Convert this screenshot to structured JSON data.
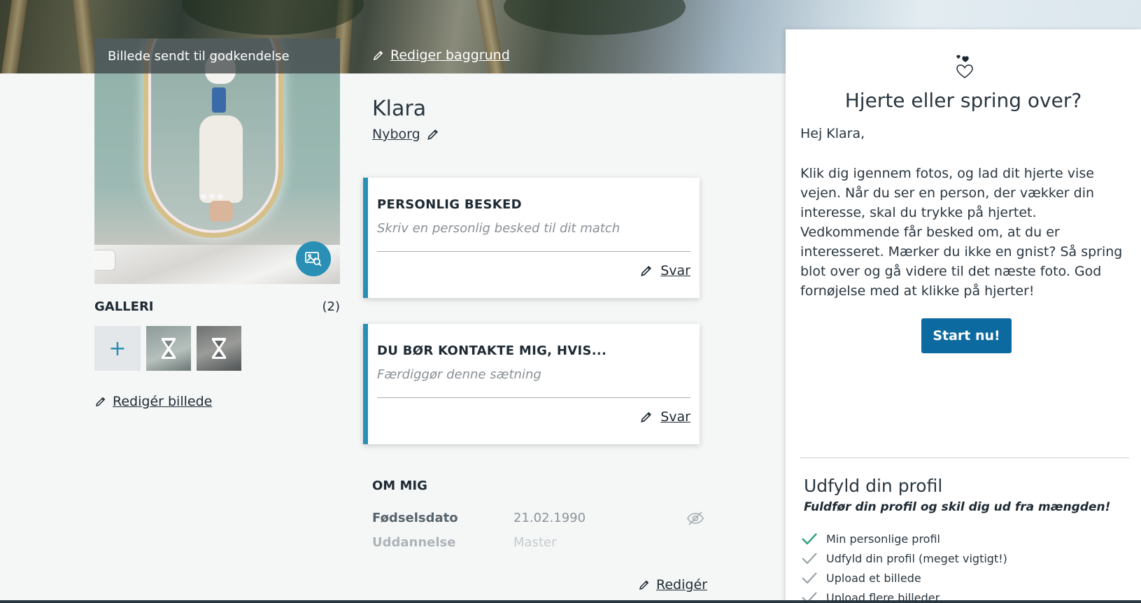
{
  "hero": {
    "edit_background_label": "Rediger baggrund"
  },
  "photo": {
    "approval_text": "Billede sendt til godkendelse"
  },
  "gallery": {
    "title": "GALLERI",
    "count": "(2)",
    "edit_photo_label": "Redigér billede"
  },
  "profile": {
    "name": "Klara",
    "city": "Nyborg"
  },
  "questions": [
    {
      "title": "PERSONLIG BESKED",
      "placeholder": "Skriv en personlig besked til dit match",
      "answer_label": "Svar"
    },
    {
      "title": "DU BØR KONTAKTE MIG, HVIS...",
      "placeholder": "Færdiggør denne sætning",
      "answer_label": "Svar"
    }
  ],
  "about": {
    "title": "OM MIG",
    "rows": [
      {
        "label": "Fødselsdato",
        "value": "21.02.1990"
      },
      {
        "label": "Uddannelse",
        "value": "Master"
      }
    ],
    "edit_label": "Redigér"
  },
  "panel": {
    "title": "Hjerte eller spring over?",
    "greeting": "Hej Klara,",
    "body": "Klik dig igennem fotos, og lad dit hjerte vise vejen. Når du ser en person, der vækker din interesse, skal du trykke på hjertet. Vedkommende får besked om, at du er interesseret. Mærker du ikke en gnist? Så spring blot over og gå videre til det næste foto. God fornøjelse med at klikke på hjerter!",
    "start_label": "Start nu!",
    "profile_title": "Udfyld din profil",
    "profile_subtitle": "Fuldfør din profil og skil dig ud fra mængden!",
    "checklist": [
      {
        "label": "Min personlige profil",
        "done": true
      },
      {
        "label": "Udfyld din profil (meget vigtigt!)",
        "done": false
      },
      {
        "label": "Upload et billede",
        "done": false
      },
      {
        "label": "Upload flere billeder",
        "done": false
      }
    ]
  },
  "colors": {
    "accent": "#2a8fb5",
    "button": "#0d6aa0",
    "check_done": "#2aa37a",
    "check_pending": "#9aa3a8"
  },
  "icons": [
    "pencil-icon",
    "image-search-icon",
    "hourglass-icon",
    "plus-icon",
    "eye-slash-icon",
    "hearts-icon",
    "check-icon"
  ]
}
